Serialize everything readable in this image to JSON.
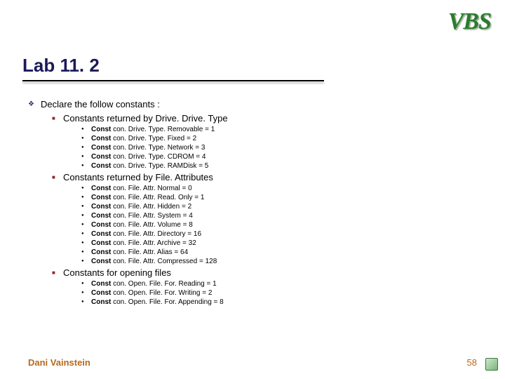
{
  "logo_text": "VBS",
  "title": "Lab 11. 2",
  "intro": "Declare the follow constants :",
  "sections": [
    {
      "heading": "Constants returned by Drive. Drive. Type",
      "items": [
        {
          "kw": "Const",
          "rest": " con. Drive. Type. Removable = 1"
        },
        {
          "kw": "Const",
          "rest": " con. Drive. Type. Fixed = 2"
        },
        {
          "kw": "Const",
          "rest": " con. Drive. Type. Network = 3"
        },
        {
          "kw": "Const",
          "rest": " con. Drive. Type. CDROM = 4"
        },
        {
          "kw": "Const",
          "rest": " con. Drive. Type. RAMDisk = 5"
        }
      ]
    },
    {
      "heading": "Constants returned by File. Attributes",
      "items": [
        {
          "kw": "Const",
          "rest": " con. File. Attr. Normal = 0"
        },
        {
          "kw": "Const",
          "rest": " con. File. Attr. Read. Only = 1"
        },
        {
          "kw": "Const",
          "rest": " con. File. Attr. Hidden = 2"
        },
        {
          "kw": "Const",
          "rest": " con. File. Attr. System = 4"
        },
        {
          "kw": "Const",
          "rest": " con. File. Attr. Volume = 8"
        },
        {
          "kw": "Const",
          "rest": " con. File. Attr. Directory = 16"
        },
        {
          "kw": "Const",
          "rest": " con. File. Attr. Archive = 32"
        },
        {
          "kw": "Const",
          "rest": " con. File. Attr. Alias = 64"
        },
        {
          "kw": "Const",
          "rest": " con. File. Attr. Compressed = 128"
        }
      ]
    },
    {
      "heading": "Constants for opening files",
      "items": [
        {
          "kw": "Const",
          "rest": " con. Open. File. For. Reading = 1"
        },
        {
          "kw": "Const",
          "rest": " con. Open. File. For. Writing = 2"
        },
        {
          "kw": "Const",
          "rest": " con. Open. File. For. Appending = 8"
        }
      ]
    }
  ],
  "footer_author": "Dani Vainstein",
  "page_number": "58"
}
